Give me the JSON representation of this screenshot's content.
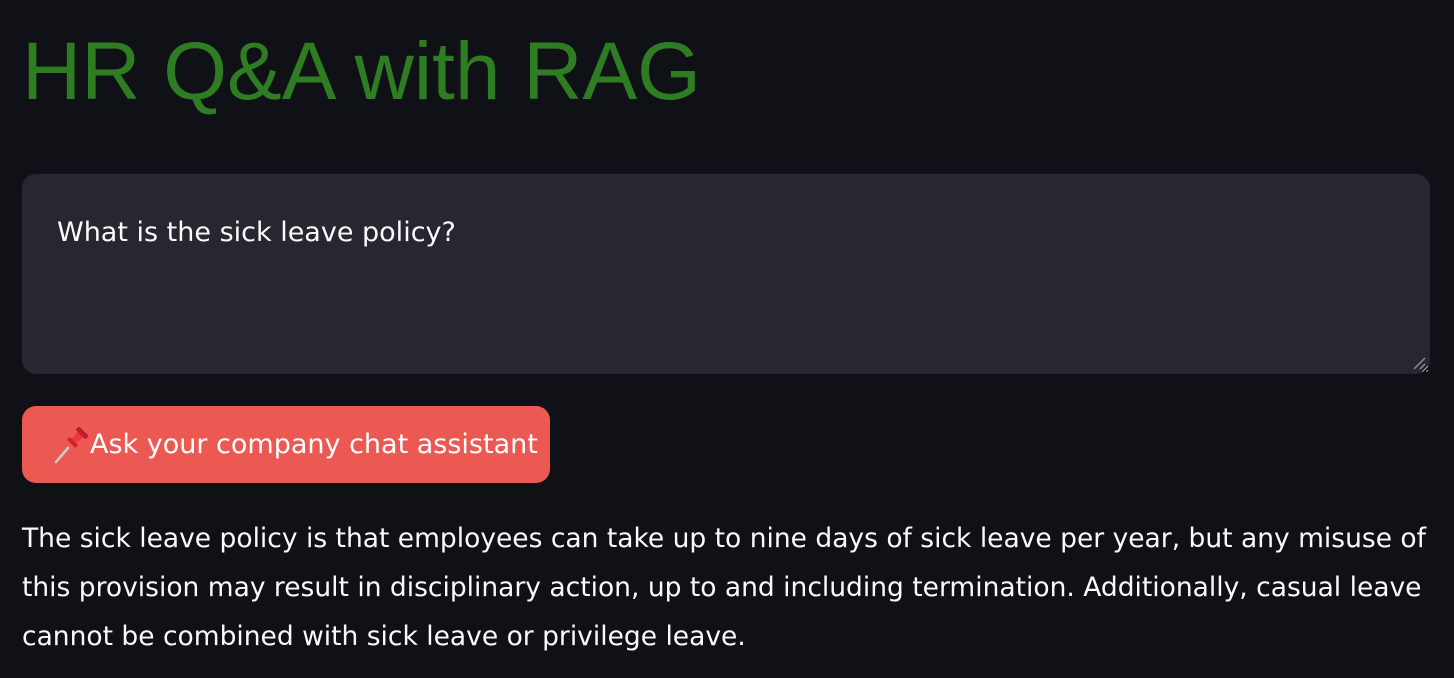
{
  "header": {
    "title": "HR Q&A with RAG"
  },
  "question": {
    "value": "What is the sick leave policy?",
    "placeholder": ""
  },
  "ask_button": {
    "icon": "pushpin-icon",
    "label": "Ask your company chat assistant"
  },
  "answer": {
    "text": "The sick leave policy is that employees can take up to nine days of sick leave per year, but any misuse of this provision may result in disciplinary action, up to and including termination. Additionally, casual leave cannot be combined with sick leave or privilege leave."
  },
  "colors": {
    "background": "#0f1117",
    "title": "#2e7d22",
    "input_background": "#262730",
    "button": "#ec5953",
    "text": "#fafafa"
  }
}
